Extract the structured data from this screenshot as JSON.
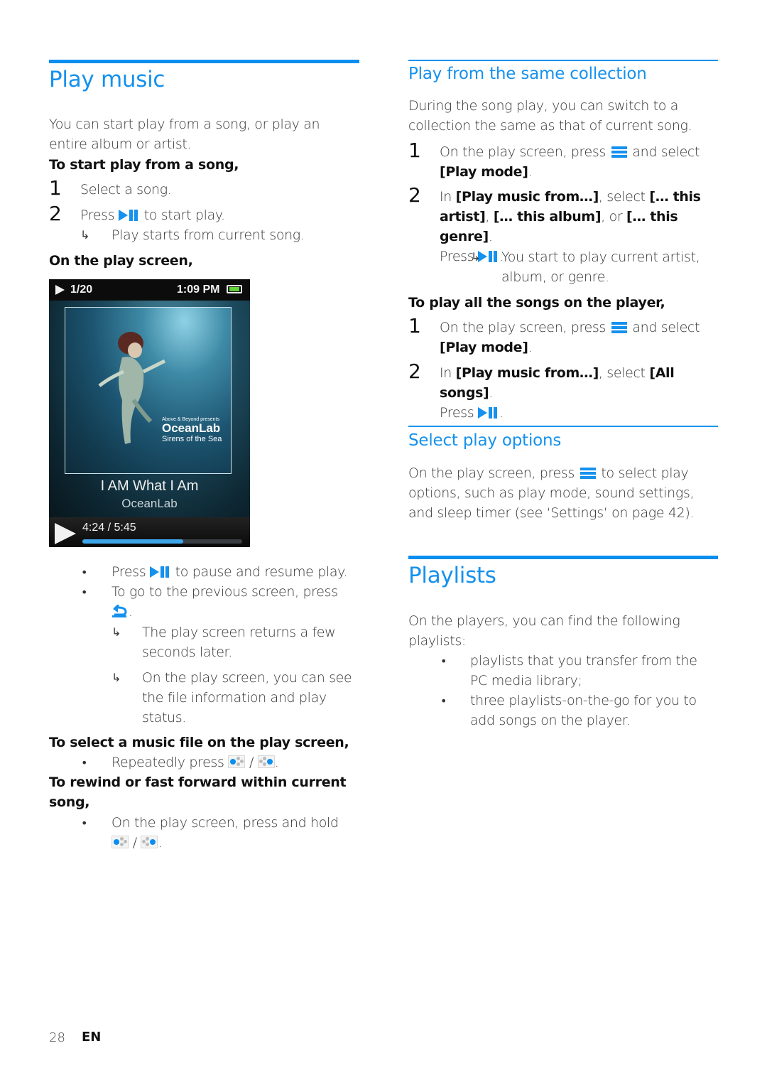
{
  "colors": {
    "accent": "#1591ee",
    "rule": "#0a8ef0",
    "text": "#333333"
  },
  "left": {
    "title": "Play music",
    "intro": "You can start play from a song, or play an entire album or artist.",
    "start_heading": "To start play from a song,",
    "steps": [
      {
        "num": "1",
        "text": "Select a song."
      },
      {
        "num": "2",
        "text_before": "Press",
        "text_after": "to start play.",
        "icon": "play-pause-icon"
      }
    ],
    "step2_result": "Play starts from current song.",
    "play_screen_heading": "On the play screen,",
    "device": {
      "status_track": "1/20",
      "status_time": "1:09 PM",
      "battery_icon": "battery-full-icon",
      "album_presents": "Above & Beyond presents",
      "album_artist": "OceanLab",
      "album_name": "Sirens of the Sea",
      "song_title": "I AM What I Am",
      "song_artist": "OceanLab",
      "elapsed_total": "4:24 / 5:45",
      "progress_fraction": 0.63
    },
    "bullets": [
      {
        "text_before": "Press",
        "text_after": "to pause and resume play.",
        "icon": "play-pause-icon"
      },
      {
        "text_before": "To go to the previous screen, press",
        "text_after": ".",
        "icon": "back-icon"
      }
    ],
    "bullet2_results": [
      "The play screen returns a few seconds later.",
      "On the play screen, you can see the file information and play status."
    ],
    "select_heading": "To select a music file on the play screen,",
    "select_bullet": {
      "text_before": "Repeatedly press",
      "sep": "/",
      "end": ".",
      "icons": [
        "previous-icon",
        "next-icon"
      ]
    },
    "rewind_heading": "To rewind or fast forward within current song,",
    "rewind_bullet": {
      "text_before": "On the play screen, press and hold",
      "sep": "/",
      "end": ".",
      "icons": [
        "previous-icon",
        "next-icon"
      ]
    }
  },
  "right": {
    "collection": {
      "title": "Play from the same collection",
      "intro": "During the song play, you can switch to a collection the same as that of current song.",
      "step1": {
        "num": "1",
        "text_before": "On the play screen, press",
        "text_after": "and select",
        "option": "[Play mode]",
        "end": "."
      },
      "step2": {
        "num": "2",
        "in": "In",
        "menu": "[Play music from…]",
        "select": ", select",
        "opt1": "[… this artist]",
        "comma": ",",
        "opt2": "[… this album]",
        "or": ", or",
        "opt3": "[… this genre]",
        "end": ".",
        "press": "Press",
        "press_end": "."
      },
      "result": "You start to play current artist, album, or genre."
    },
    "all_songs": {
      "heading": "To play all the songs on the player,",
      "step1": {
        "num": "1",
        "text_before": "On the play screen, press",
        "text_after": "and select",
        "option": "[Play mode]",
        "end": "."
      },
      "step2": {
        "num": "2",
        "in": "In",
        "menu": "[Play music from…]",
        "select": ", select",
        "opt": "[All songs]",
        "end": ".",
        "press": "Press",
        "press_end": "."
      }
    },
    "options": {
      "title": "Select play options",
      "text_before": "On the play screen, press",
      "text_after": "to select play options, such as play mode, sound settings, and sleep timer (see ‘Settings’ on page 42)."
    },
    "playlists": {
      "title": "Playlists",
      "intro": "On the players, you can find the following playlists:",
      "items": [
        "playlists that you transfer from the PC media library;",
        "three playlists-on-the-go for you to add songs on the player."
      ]
    }
  },
  "footer": {
    "page_number": "28",
    "language": "EN"
  }
}
